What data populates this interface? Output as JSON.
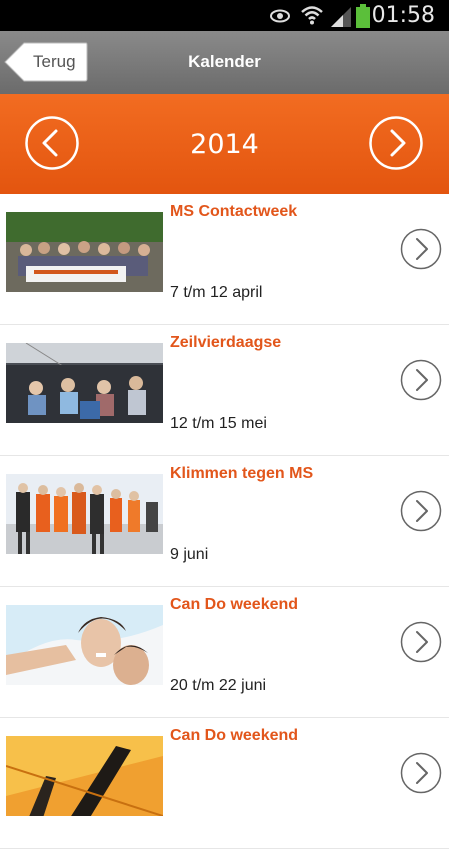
{
  "status_bar": {
    "time": "01:58",
    "icons": [
      "eye-icon",
      "wifi-icon",
      "signal-icon",
      "battery-icon"
    ]
  },
  "nav": {
    "back_label": "Terug",
    "title": "Kalender"
  },
  "year_bar": {
    "year": "2014",
    "prev_icon": "chevron-left-icon",
    "next_icon": "chevron-right-icon"
  },
  "colors": {
    "accent": "#e3550f",
    "title_text": "#e2561b",
    "nav_bar": "#7a7a7a"
  },
  "events": [
    {
      "title": "MS Contactweek",
      "date": "7 t/m 12 april"
    },
    {
      "title": "Zeilvierdaagse",
      "date": "12 t/m 15 mei"
    },
    {
      "title": "Klimmen tegen MS",
      "date": "9 juni"
    },
    {
      "title": "Can Do weekend",
      "date": "20 t/m 22 juni"
    },
    {
      "title": "Can Do weekend",
      "date": ""
    }
  ]
}
